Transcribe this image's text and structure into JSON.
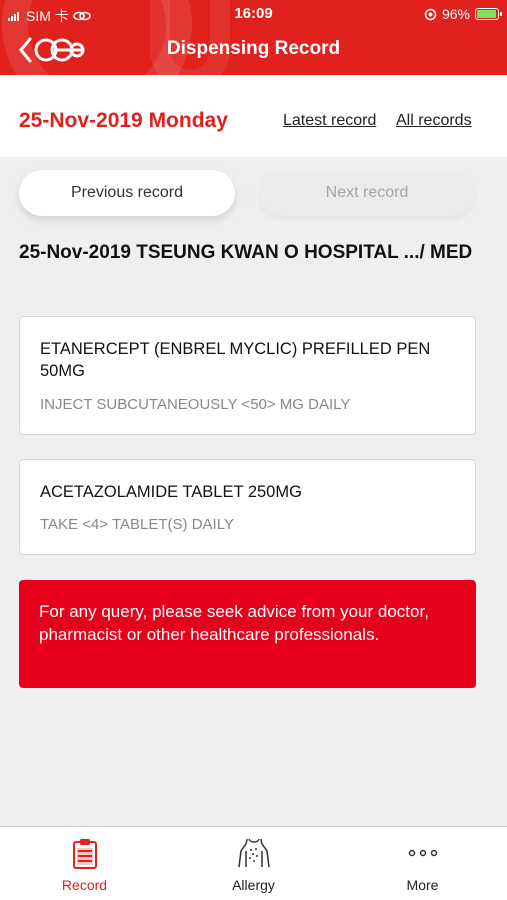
{
  "status_bar": {
    "carrier": "SIM 卡",
    "time": "16:09",
    "battery": "96%",
    "battery_level": 0.96
  },
  "header": {
    "title": "Dispensing Record",
    "back_icon": "chevron-left-icon",
    "logo_icon": "app-logo-icon"
  },
  "date_row": {
    "date": "25-Nov-2019 Monday",
    "latest_link": "Latest record",
    "all_link": "All records"
  },
  "navigation": {
    "prev_label": "Previous record",
    "next_label": "Next record"
  },
  "record": {
    "title": "25-Nov-2019 TSEUNG KWAN O HOSPITAL .../ MED",
    "drugs": [
      {
        "name": "ETANERCEPT (ENBREL MYCLIC) PREFILLED PEN 50MG",
        "instruction": "INJECT SUBCUTANEOUSLY <50> MG DAILY"
      },
      {
        "name": "ACETAZOLAMIDE TABLET 250MG",
        "instruction": "TAKE <4> TABLET(S) DAILY"
      }
    ]
  },
  "notice": "For any query, please seek advice from your doctor, pharmacist or other healthcare professionals.",
  "tabbar": {
    "items": [
      {
        "label": "Record",
        "icon": "clipboard-icon",
        "active": true
      },
      {
        "label": "Allergy",
        "icon": "allergy-body-icon",
        "active": false
      },
      {
        "label": "More",
        "icon": "more-dots-icon",
        "active": false
      }
    ]
  },
  "colors": {
    "brand_red": "#e0211d",
    "notice_red": "#e6001a",
    "battery_green": "#7be05a"
  }
}
